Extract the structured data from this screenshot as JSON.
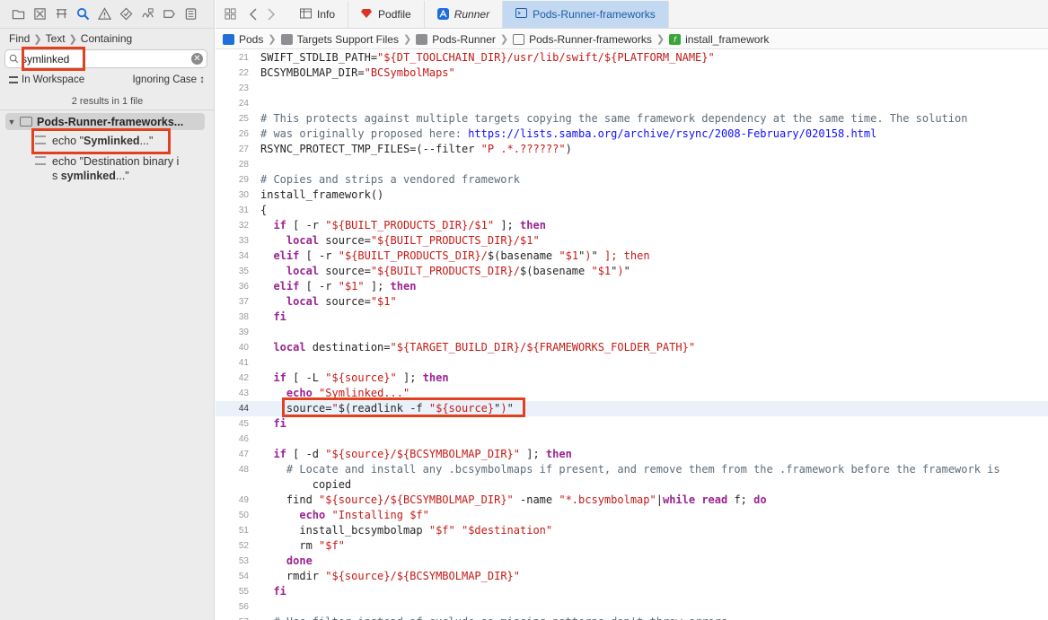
{
  "navigator": {
    "toolbar_icons": [
      "folder-icon",
      "source-control-icon",
      "symbol-icon",
      "find-icon",
      "issue-icon",
      "test-icon",
      "debug-icon",
      "breakpoint-icon",
      "report-icon"
    ],
    "find_path": [
      "Find",
      "Text",
      "Containing"
    ],
    "search": {
      "value": "symlinked",
      "placeholder": ""
    },
    "scope": "In Workspace",
    "case": "Ignoring Case ↕",
    "results_count": "2 results in 1 file",
    "result_file": "Pods-Runner-frameworks...",
    "results": [
      {
        "pre": "echo \"",
        "match": "Symlinked",
        "post": "...\""
      },
      {
        "pre": "echo \"Destination binary i",
        "pre2": "s ",
        "match": "symlinked",
        "post": "...\""
      }
    ]
  },
  "tabs": [
    {
      "label": "Info",
      "icon": "table-icon"
    },
    {
      "label": "Podfile",
      "icon": "ruby-icon"
    },
    {
      "label": "Runner",
      "icon": "app-icon"
    },
    {
      "label": "Pods-Runner-frameworks",
      "icon": "script-icon",
      "active": true
    }
  ],
  "jumpbar": [
    "Pods",
    "Targets Support Files",
    "Pods-Runner",
    "Pods-Runner-frameworks",
    "install_framework"
  ],
  "colors": {
    "highlight_box": "#e2411f",
    "keyword": "#9b2393",
    "string": "#c41a16",
    "comment": "#5d6c79",
    "url": "#0e0eff",
    "active_tab": "#c3d9f2"
  },
  "code": [
    {
      "n": "21",
      "t": "SWIFT_STDLIB_PATH=\"${DT_TOOLCHAIN_DIR}/usr/lib/swift/${PLATFORM_NAME}\""
    },
    {
      "n": "22",
      "t": "BCSYMBOLMAP_DIR=\"BCSymbolMaps\""
    },
    {
      "n": "23",
      "t": ""
    },
    {
      "n": "24",
      "t": ""
    },
    {
      "n": "25",
      "t": "# This protects against multiple targets copying the same framework dependency at the same time. The solution"
    },
    {
      "n": "26",
      "t": "# was originally proposed here: https://lists.samba.org/archive/rsync/2008-February/020158.html"
    },
    {
      "n": "27",
      "t": "RSYNC_PROTECT_TMP_FILES=(--filter \"P .*.??????\")"
    },
    {
      "n": "28",
      "t": ""
    },
    {
      "n": "29",
      "t": "# Copies and strips a vendored framework"
    },
    {
      "n": "30",
      "t": "install_framework()"
    },
    {
      "n": "31",
      "t": "{"
    },
    {
      "n": "32",
      "t": "  if [ -r \"${BUILT_PRODUCTS_DIR}/$1\" ]; then"
    },
    {
      "n": "33",
      "t": "    local source=\"${BUILT_PRODUCTS_DIR}/$1\""
    },
    {
      "n": "34",
      "t": "  elif [ -r \"${BUILT_PRODUCTS_DIR}/$(basename \"$1\")\" ]; then"
    },
    {
      "n": "35",
      "t": "    local source=\"${BUILT_PRODUCTS_DIR}/$(basename \"$1\")\""
    },
    {
      "n": "36",
      "t": "  elif [ -r \"$1\" ]; then"
    },
    {
      "n": "37",
      "t": "    local source=\"$1\""
    },
    {
      "n": "38",
      "t": "  fi"
    },
    {
      "n": "39",
      "t": ""
    },
    {
      "n": "40",
      "t": "  local destination=\"${TARGET_BUILD_DIR}/${FRAMEWORKS_FOLDER_PATH}\""
    },
    {
      "n": "41",
      "t": ""
    },
    {
      "n": "42",
      "t": "  if [ -L \"${source}\" ]; then"
    },
    {
      "n": "43",
      "t": "    echo \"Symlinked...\""
    },
    {
      "n": "44",
      "t": "    source=\"$(readlink -f \"${source}\")\"",
      "current": true
    },
    {
      "n": "45",
      "t": "  fi"
    },
    {
      "n": "46",
      "t": ""
    },
    {
      "n": "47",
      "t": "  if [ -d \"${source}/${BCSYMBOLMAP_DIR}\" ]; then"
    },
    {
      "n": "48",
      "t": "    # Locate and install any .bcsymbolmaps if present, and remove them from the .framework before the framework is"
    },
    {
      "n": "",
      "t": "        copied"
    },
    {
      "n": "49",
      "t": "    find \"${source}/${BCSYMBOLMAP_DIR}\" -name \"*.bcsymbolmap\"|while read f; do"
    },
    {
      "n": "50",
      "t": "      echo \"Installing $f\""
    },
    {
      "n": "51",
      "t": "      install_bcsymbolmap \"$f\" \"$destination\""
    },
    {
      "n": "52",
      "t": "      rm \"$f\""
    },
    {
      "n": "53",
      "t": "    done"
    },
    {
      "n": "54",
      "t": "    rmdir \"${source}/${BCSYMBOLMAP_DIR}\""
    },
    {
      "n": "55",
      "t": "  fi"
    },
    {
      "n": "56",
      "t": ""
    },
    {
      "n": "57",
      "t": "  # Use filter instead of exclude so missing patterns don't throw errors."
    }
  ]
}
